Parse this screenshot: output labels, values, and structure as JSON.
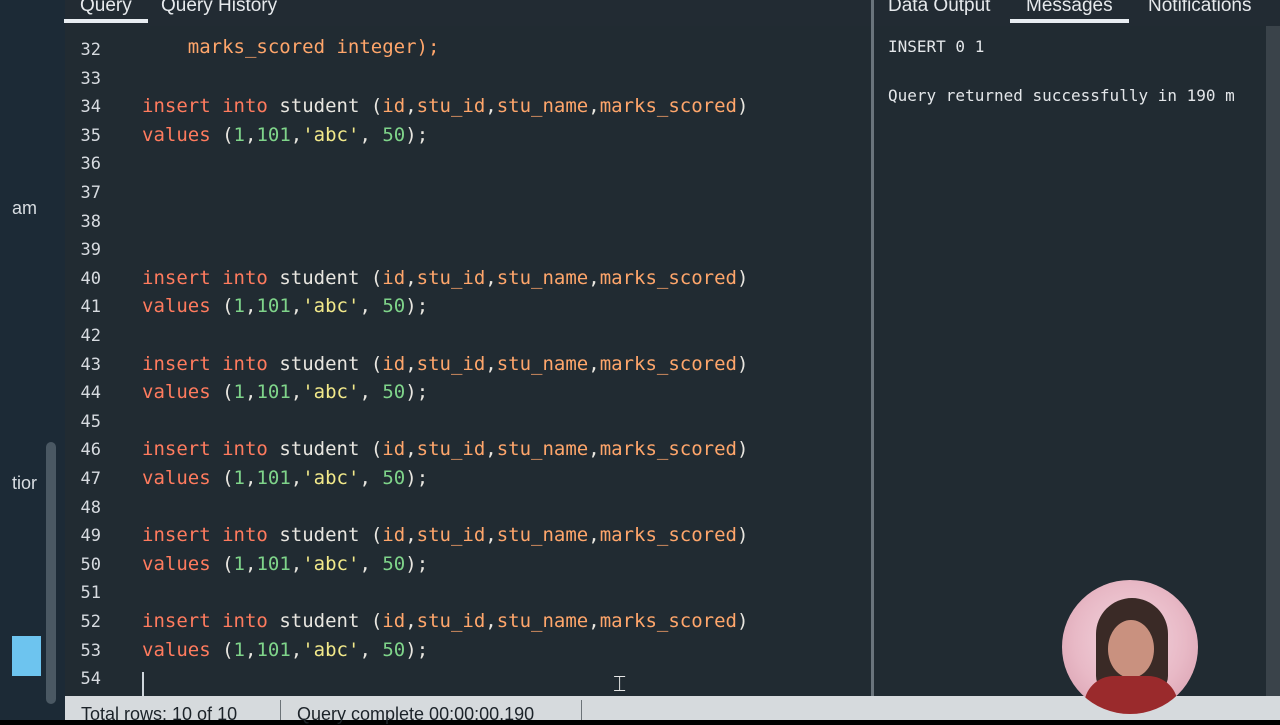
{
  "tabs": {
    "query": "Query",
    "query_history": "Query History",
    "data_output": "Data Output",
    "messages": "Messages",
    "notifications": "Notifications"
  },
  "left_rail": {
    "fragment_1": "am",
    "fragment_2": "tior"
  },
  "editor": {
    "partial_top_line": "marks_scored integer);",
    "lines": [
      {
        "n": "32",
        "code": ""
      },
      {
        "n": "33",
        "code": ""
      },
      {
        "n": "34",
        "code": "insert into student (id,stu_id,stu_name,marks_scored)"
      },
      {
        "n": "35",
        "code": "values (1,101,'abc', 50);"
      },
      {
        "n": "36",
        "code": ""
      },
      {
        "n": "37",
        "code": ""
      },
      {
        "n": "38",
        "code": ""
      },
      {
        "n": "39",
        "code": ""
      },
      {
        "n": "40",
        "code": "insert into student (id,stu_id,stu_name,marks_scored)"
      },
      {
        "n": "41",
        "code": "values (1,101,'abc', 50);"
      },
      {
        "n": "42",
        "code": ""
      },
      {
        "n": "43",
        "code": "insert into student (id,stu_id,stu_name,marks_scored)"
      },
      {
        "n": "44",
        "code": "values (1,101,'abc', 50);"
      },
      {
        "n": "45",
        "code": ""
      },
      {
        "n": "46",
        "code": "insert into student (id,stu_id,stu_name,marks_scored)"
      },
      {
        "n": "47",
        "code": "values (1,101,'abc', 50);"
      },
      {
        "n": "48",
        "code": ""
      },
      {
        "n": "49",
        "code": "insert into student (id,stu_id,stu_name,marks_scored)"
      },
      {
        "n": "50",
        "code": "values (1,101,'abc', 50);"
      },
      {
        "n": "51",
        "code": ""
      },
      {
        "n": "52",
        "code": "insert into student (id,stu_id,stu_name,marks_scored)"
      },
      {
        "n": "53",
        "code": "values (1,101,'abc', 50);"
      },
      {
        "n": "54",
        "code": ""
      }
    ]
  },
  "messages": {
    "line1": "INSERT 0 1",
    "line2": "Query returned successfully in 190 m"
  },
  "status": {
    "total_rows": "Total rows: 10 of 10",
    "query_complete": "Query complete 00:00:00.190"
  },
  "colors": {
    "editor_bg": "#212b32",
    "keyword": "#ff7b5e",
    "identifier": "#ffa66b",
    "number": "#7fd48a",
    "string": "#f2e98a"
  }
}
